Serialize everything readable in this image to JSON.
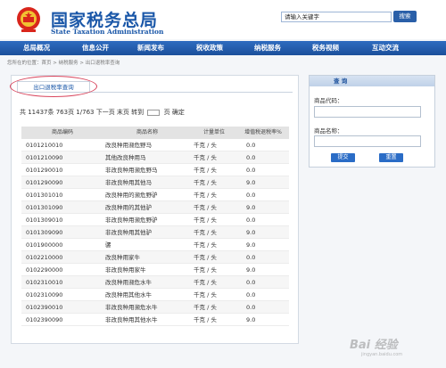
{
  "header": {
    "logo_cn": "国家税务总局",
    "logo_en": "State Taxation Administration",
    "search_placeholder": "请输入关键字",
    "search_button": "搜索"
  },
  "nav": [
    "总局概况",
    "信息公开",
    "新闻发布",
    "税收政策",
    "纳税服务",
    "税务视频",
    "互动交流"
  ],
  "breadcrumb": "您所在的位置：首页 > 纳税服务 > 出口退税率查询",
  "tab_label": "出口退税率查询",
  "pager": {
    "before": "共 11437条 763页 1/763 下一页 末页 转到",
    "after": "页 确定"
  },
  "table": {
    "headers": [
      "商品编码",
      "商品名称",
      "计量单位",
      "增值税退税率%"
    ],
    "rows": [
      [
        "0101210010",
        "改良种用濒危野马",
        "千克 / 头",
        "0.0"
      ],
      [
        "0101210090",
        "其他改良种用马",
        "千克 / 头",
        "0.0"
      ],
      [
        "0101290010",
        "非改良种用濒危野马",
        "千克 / 头",
        "0.0"
      ],
      [
        "0101290090",
        "非改良种用其他马",
        "千克 / 头",
        "9.0"
      ],
      [
        "0101301010",
        "改良种用的濒危野驴",
        "千克 / 头",
        "0.0"
      ],
      [
        "0101301090",
        "改良种用的其他驴",
        "千克 / 头",
        "9.0"
      ],
      [
        "0101309010",
        "非改良种用濒危野驴",
        "千克 / 头",
        "0.0"
      ],
      [
        "0101309090",
        "非改良种用其他驴",
        "千克 / 头",
        "9.0"
      ],
      [
        "0101900000",
        "骡",
        "千克 / 头",
        "9.0"
      ],
      [
        "0102210000",
        "改良种用家牛",
        "千克 / 头",
        "0.0"
      ],
      [
        "0102290000",
        "非改良种用家牛",
        "千克 / 头",
        "9.0"
      ],
      [
        "0102310010",
        "改良种用濒危水牛",
        "千克 / 头",
        "0.0"
      ],
      [
        "0102310090",
        "改良种用其他水牛",
        "千克 / 头",
        "0.0"
      ],
      [
        "0102390010",
        "非改良种用濒危水牛",
        "千克 / 头",
        "0.0"
      ],
      [
        "0102390090",
        "非改良种用其他水牛",
        "千克 / 头",
        "9.0"
      ]
    ]
  },
  "side": {
    "title": "查 询",
    "code_label": "商品代码：",
    "name_label": "商品名称：",
    "submit": "提交",
    "reset": "重置"
  },
  "watermark": {
    "main": "Bai 经验",
    "sub": "jingyan.baidu.com"
  },
  "colors": {
    "brand": "#1a57a8",
    "nav": "#1b4f9b",
    "highlight_oval": "#d8445c"
  },
  "icons": [
    "national-emblem-icon"
  ]
}
